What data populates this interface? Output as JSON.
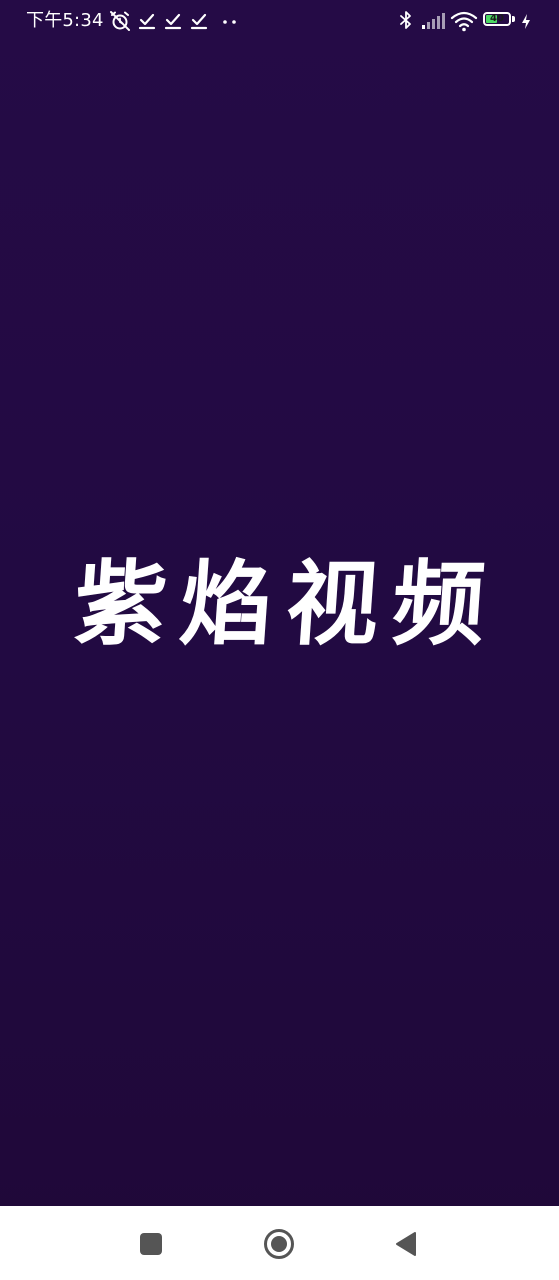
{
  "status_bar": {
    "time": "下午5:34",
    "battery_level": "40",
    "icons": [
      "muted-alarm-icon",
      "check-notification-icon",
      "check-notification-icon",
      "check-notification-icon",
      "more-notifications-icon",
      "bluetooth-icon",
      "signal-icon",
      "wifi-icon",
      "battery-icon",
      "charging-icon"
    ]
  },
  "splash": {
    "title": "紫焰视频"
  },
  "nav_bar": {
    "buttons": [
      "recent-apps",
      "home",
      "back"
    ]
  },
  "colors": {
    "background_top": "#250b46",
    "background_bottom": "#1f0838",
    "nav_background": "#ffffff",
    "nav_icon": "#555555",
    "battery_fill": "#4cd964"
  }
}
